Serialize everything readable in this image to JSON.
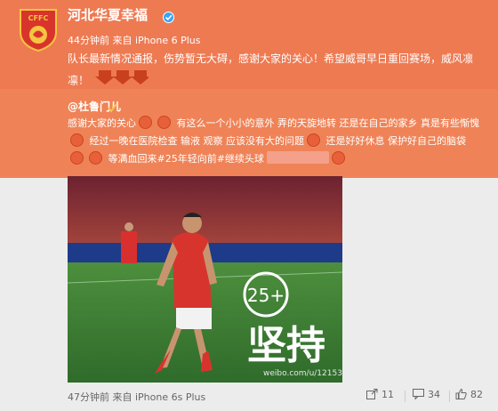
{
  "account": {
    "name": "河北华夏幸福",
    "logo_text": "CFFC",
    "meta": "44分钟前 来自 iPhone 6 Plus",
    "post_text": "队长最新情况通报，伤势暂无大碍，感谢大家的关心！希望威哥早日重回赛场，威风凛凛！"
  },
  "repost": {
    "author": "@杜鲁门儿",
    "segments": [
      "感谢大家的关心",
      "有这么一个小小的意外 弄的天旋地转 还是在自己的家乡 真是有些惭愧",
      "经过一晚在医院检查 输液 观察 应该没有大的问题",
      "还是好好休息 保护好自己的脑袋",
      "等满血回来#25年轻向前#继续头球"
    ],
    "photo_overlay": "25+",
    "photo_overlay_word": "坚持",
    "photo_watermark": "weibo.com/u/12153",
    "footer": {
      "meta": "47分钟前 来自 iPhone 6s Plus",
      "share_count": "11",
      "comment_count": "34",
      "like_count": "82"
    }
  },
  "colors": {
    "header_bg": "#ee7a52",
    "repost_bg": "#ef8357",
    "text": "#ffffff"
  }
}
